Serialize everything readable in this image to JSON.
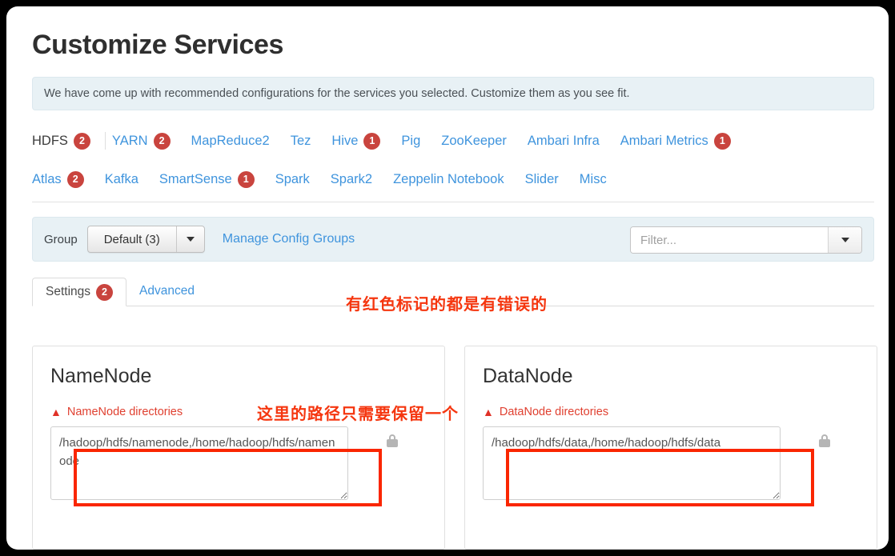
{
  "header": {
    "title": "Customize Services",
    "info_banner": "We have come up with recommended configurations for the services you selected. Customize them as you see fit."
  },
  "service_tabs": {
    "row1": [
      {
        "label": "HDFS",
        "badge": "2",
        "active": true
      },
      {
        "label": "YARN",
        "badge": "2",
        "active": false
      },
      {
        "label": "MapReduce2",
        "badge": "",
        "active": false
      },
      {
        "label": "Tez",
        "badge": "",
        "active": false
      },
      {
        "label": "Hive",
        "badge": "1",
        "active": false
      },
      {
        "label": "Pig",
        "badge": "",
        "active": false
      },
      {
        "label": "ZooKeeper",
        "badge": "",
        "active": false
      },
      {
        "label": "Ambari Infra",
        "badge": "",
        "active": false
      },
      {
        "label": "Ambari Metrics",
        "badge": "1",
        "active": false
      }
    ],
    "row2": [
      {
        "label": "Atlas",
        "badge": "2",
        "active": false
      },
      {
        "label": "Kafka",
        "badge": "",
        "active": false
      },
      {
        "label": "SmartSense",
        "badge": "1",
        "active": false
      },
      {
        "label": "Spark",
        "badge": "",
        "active": false
      },
      {
        "label": "Spark2",
        "badge": "",
        "active": false
      },
      {
        "label": "Zeppelin Notebook",
        "badge": "",
        "active": false
      },
      {
        "label": "Slider",
        "badge": "",
        "active": false
      },
      {
        "label": "Misc",
        "badge": "",
        "active": false
      }
    ]
  },
  "group_bar": {
    "group_label": "Group",
    "group_value": "Default (3)",
    "manage_link": "Manage Config Groups",
    "filter_placeholder": "Filter...",
    "filter_value": ""
  },
  "subtabs": [
    {
      "label": "Settings",
      "badge": "2",
      "active": true
    },
    {
      "label": "Advanced",
      "badge": "",
      "active": false
    }
  ],
  "annotations": {
    "errors_note": "有红色标记的都是有错误的",
    "paths_note": "这里的路径只需要保留一个"
  },
  "panels": [
    {
      "title": "NameNode",
      "property_label": "NameNode directories",
      "property_value": "/hadoop/hdfs/namenode,/home/hadoop/hdfs/namenode",
      "locked": true
    },
    {
      "title": "DataNode",
      "property_label": "DataNode directories",
      "property_value": "/hadoop/hdfs/data,/home/hadoop/hdfs/data",
      "locked": true
    }
  ],
  "colors": {
    "link": "#3f94dd",
    "badge": "#c9443e",
    "error_text": "#e04030",
    "annotation_red": "#f5360f",
    "banner_bg": "#e8f1f5"
  }
}
